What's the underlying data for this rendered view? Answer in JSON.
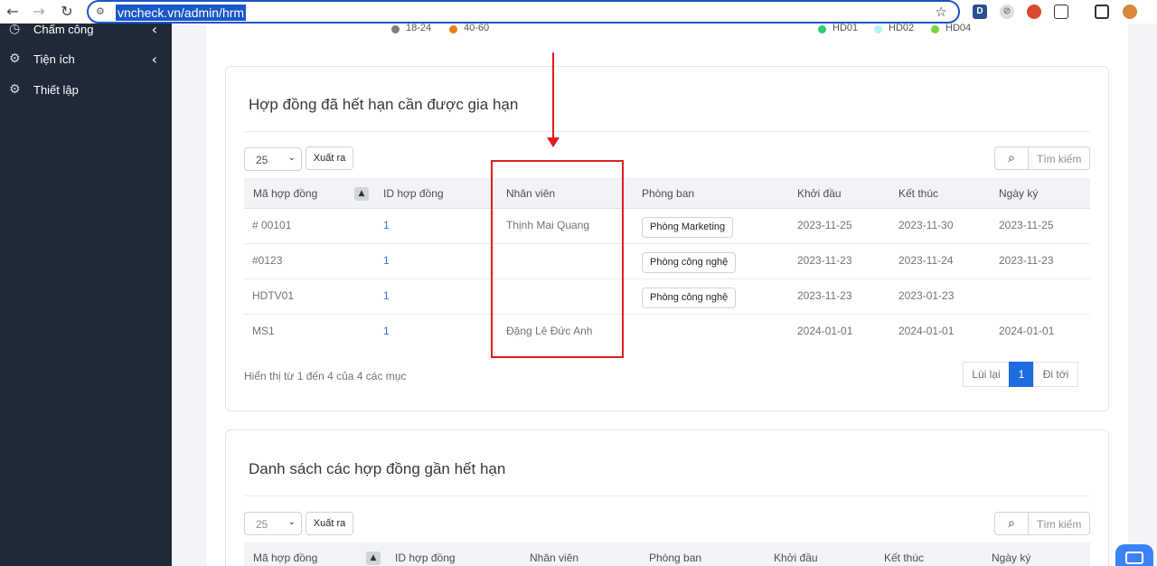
{
  "browser": {
    "url": "vncheck.vn/admin/hrm",
    "back_icon": "back-arrow-icon",
    "forward_icon": "forward-arrow-icon",
    "reload_icon": "reload-icon",
    "ext1_label": "D"
  },
  "sidebar": {
    "items": [
      {
        "label": "Chấm công",
        "icon": "clock-icon"
      },
      {
        "label": "Tiện ích",
        "icon": "gears-icon"
      },
      {
        "label": "Thiết lập",
        "icon": "gear-icon"
      }
    ]
  },
  "top_legend": {
    "left": [
      {
        "label": "18-24",
        "color": "#7d7d7d"
      },
      {
        "label": "40-60",
        "color": "#f07b1d"
      }
    ],
    "right": [
      {
        "label": "HD01",
        "color": "#2ecc71"
      },
      {
        "label": "HD02",
        "color": "#b7f0f0"
      },
      {
        "label": "HD04",
        "color": "#7bd33a"
      }
    ]
  },
  "expired_card": {
    "title": "Hợp đồng đã hết hạn cần được gia hạn",
    "page_size": "25",
    "export_label": "Xuất ra",
    "search_placeholder": "Tìm kiếm",
    "columns": [
      "Mã hợp đồng",
      "ID hợp đồng",
      "Nhân viên",
      "Phòng ban",
      "Khởi đầu",
      "Kết thúc",
      "Ngày ký"
    ],
    "rows": [
      {
        "code": "# 00101",
        "id": "1",
        "employee": "Thịnh Mai Quang",
        "dept": "Phòng Marketing",
        "start": "2023-11-25",
        "end": "2023-11-30",
        "signed": "2023-11-25"
      },
      {
        "code": "#0123",
        "id": "1",
        "employee": "",
        "dept": "Phòng công nghệ",
        "start": "2023-11-23",
        "end": "2023-11-24",
        "signed": "2023-11-23"
      },
      {
        "code": "HDTV01",
        "id": "1",
        "employee": "",
        "dept": "Phòng công nghệ",
        "start": "2023-11-23",
        "end": "2023-01-23",
        "signed": ""
      },
      {
        "code": "MS1",
        "id": "1",
        "employee": "Đặng Lê Đức Anh",
        "dept": "",
        "start": "2024-01-01",
        "end": "2024-01-01",
        "signed": "2024-01-01"
      }
    ],
    "info": "Hiển thị từ 1 đến 4 của 4 các mục",
    "pager": {
      "prev": "Lùi lại",
      "current": "1",
      "next": "Đi tới"
    }
  },
  "expiring_card": {
    "title": "Danh sách các hợp đồng gần hết hạn",
    "page_size": "25",
    "export_label": "Xuất ra",
    "search_placeholder": "Tìm kiếm",
    "columns": [
      "Mã hợp đồng",
      "ID hợp đồng",
      "Nhân viên",
      "Phòng ban",
      "Khởi đầu",
      "Kết thúc",
      "Ngày ký"
    ]
  },
  "annotation": {
    "color": "#e01d1d"
  }
}
